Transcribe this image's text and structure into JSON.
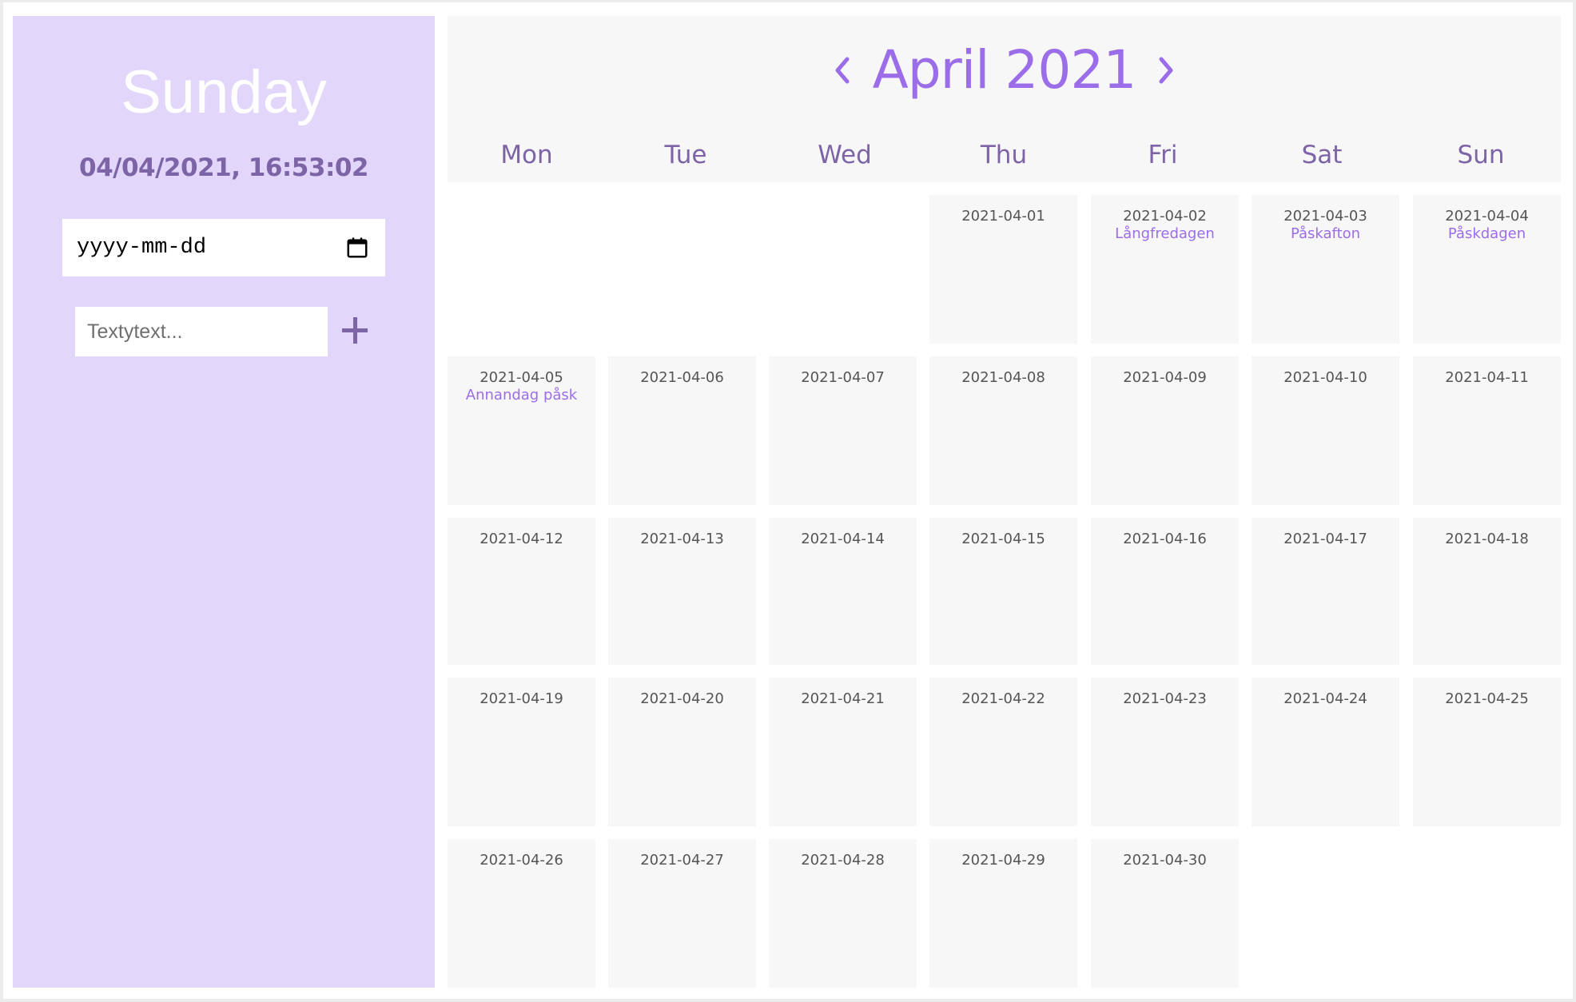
{
  "sidebar": {
    "day_name": "Sunday",
    "datetime": "04/04/2021, 16:53:02",
    "date_input_placeholder": "yyyy-mm-dd",
    "text_input_placeholder": "Textytext...",
    "add_icon": "plus-icon"
  },
  "calendar": {
    "month_title": "April 2021",
    "prev_icon": "chevron-left-icon",
    "next_icon": "chevron-right-icon",
    "weekdays": [
      "Mon",
      "Tue",
      "Wed",
      "Thu",
      "Fri",
      "Sat",
      "Sun"
    ],
    "days": [
      {
        "date": "2021-04-01",
        "holiday": ""
      },
      {
        "date": "2021-04-02",
        "holiday": "Långfredagen"
      },
      {
        "date": "2021-04-03",
        "holiday": "Påskafton"
      },
      {
        "date": "2021-04-04",
        "holiday": "Påskdagen"
      },
      {
        "date": "2021-04-05",
        "holiday": "Annandag påsk"
      },
      {
        "date": "2021-04-06",
        "holiday": ""
      },
      {
        "date": "2021-04-07",
        "holiday": ""
      },
      {
        "date": "2021-04-08",
        "holiday": ""
      },
      {
        "date": "2021-04-09",
        "holiday": ""
      },
      {
        "date": "2021-04-10",
        "holiday": ""
      },
      {
        "date": "2021-04-11",
        "holiday": ""
      },
      {
        "date": "2021-04-12",
        "holiday": ""
      },
      {
        "date": "2021-04-13",
        "holiday": ""
      },
      {
        "date": "2021-04-14",
        "holiday": ""
      },
      {
        "date": "2021-04-15",
        "holiday": ""
      },
      {
        "date": "2021-04-16",
        "holiday": ""
      },
      {
        "date": "2021-04-17",
        "holiday": ""
      },
      {
        "date": "2021-04-18",
        "holiday": ""
      },
      {
        "date": "2021-04-19",
        "holiday": ""
      },
      {
        "date": "2021-04-20",
        "holiday": ""
      },
      {
        "date": "2021-04-21",
        "holiday": ""
      },
      {
        "date": "2021-04-22",
        "holiday": ""
      },
      {
        "date": "2021-04-23",
        "holiday": ""
      },
      {
        "date": "2021-04-24",
        "holiday": ""
      },
      {
        "date": "2021-04-25",
        "holiday": ""
      },
      {
        "date": "2021-04-26",
        "holiday": ""
      },
      {
        "date": "2021-04-27",
        "holiday": ""
      },
      {
        "date": "2021-04-28",
        "holiday": ""
      },
      {
        "date": "2021-04-29",
        "holiday": ""
      },
      {
        "date": "2021-04-30",
        "holiday": ""
      }
    ]
  },
  "colors": {
    "sidebar_bg": "#e2d6fb",
    "accent_purple": "#9b6de8",
    "muted_purple": "#7c64a6",
    "cell_bg": "#f7f7f7"
  }
}
